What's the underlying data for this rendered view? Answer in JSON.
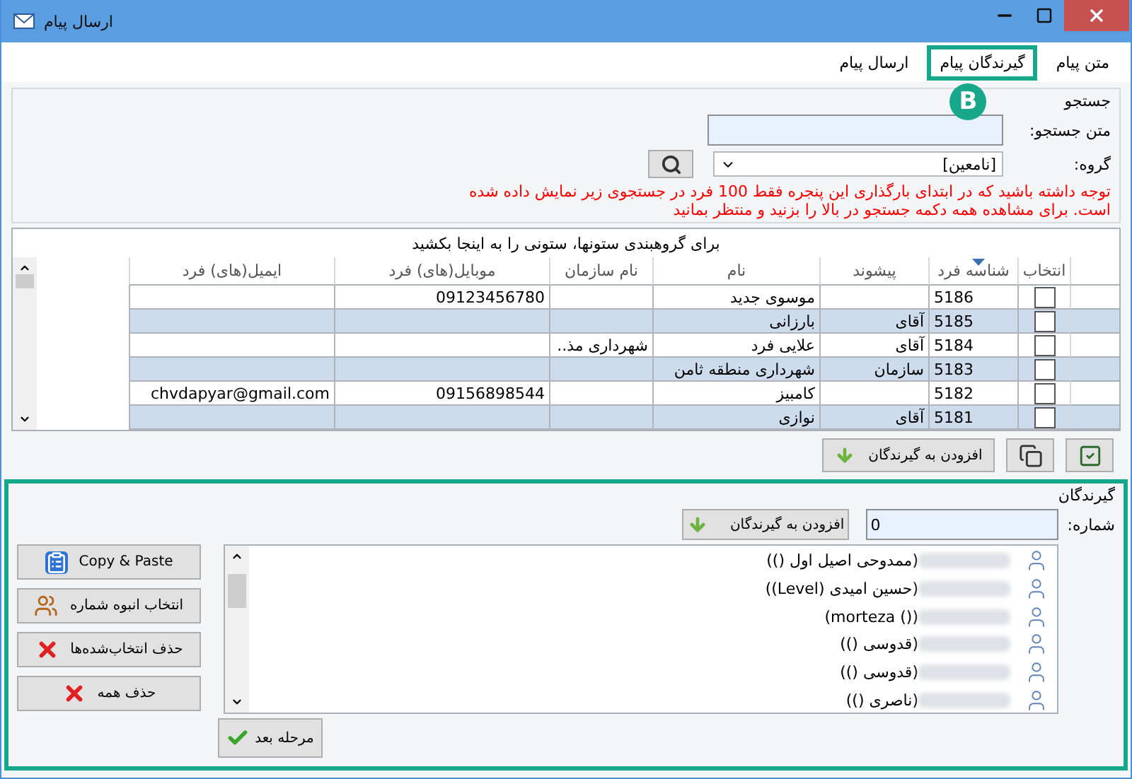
{
  "window": {
    "title": "ارسال پیام"
  },
  "tabs": [
    {
      "label": "متن پیام",
      "selected": false
    },
    {
      "label": "گیرندگان پیام",
      "selected": true,
      "badge": "B"
    },
    {
      "label": "ارسال پیام",
      "selected": false
    }
  ],
  "search": {
    "legend": "جستجو",
    "text_label": "متن جستجو:",
    "group_label": "گروه:",
    "group_value": "[نامعین]",
    "note_lines": [
      "توجه داشته باشید که در ابتدای بارگذاری این پنجره فقط 100 فرد در جستجوی زیر نمایش داده شده",
      "است. برای مشاهده همه دکمه جستجو در بالا را بزنید و منتظر بمانید"
    ]
  },
  "grid": {
    "group_hint": "برای گروهبندی ستونها، ستونی را به اینجا بکشید",
    "columns": [
      {
        "label": "انتخاب",
        "sorted": false
      },
      {
        "label": "شناسه فرد",
        "sorted": true
      },
      {
        "label": "پیشوند",
        "sorted": false
      },
      {
        "label": "نام",
        "sorted": false
      },
      {
        "label": "نام سازمان",
        "sorted": false
      },
      {
        "label": "موبایل(های) فرد",
        "sorted": false
      },
      {
        "label": "ایمیل(های) فرد",
        "sorted": false
      }
    ],
    "rows": [
      {
        "checked": false,
        "id": "5186",
        "prefix": "",
        "name": "موسوی جدید",
        "org": "",
        "mobile": "09123456780",
        "email": ""
      },
      {
        "checked": false,
        "id": "5185",
        "prefix": "آقای",
        "name": "بارزانی",
        "org": "",
        "mobile": "",
        "email": ""
      },
      {
        "checked": false,
        "id": "5184",
        "prefix": "آقای",
        "name": "علایی فرد",
        "org": "شهرداری مذ..",
        "mobile": "",
        "email": ""
      },
      {
        "checked": false,
        "id": "5183",
        "prefix": "سازمان",
        "name": "شهرداری منطقه ثامن",
        "org": "",
        "mobile": "",
        "email": ""
      },
      {
        "checked": false,
        "id": "5182",
        "prefix": "",
        "name": "کامبیز",
        "org": "",
        "mobile": "09156898544",
        "email": "chvdapyar@gmail.com"
      },
      {
        "checked": false,
        "id": "5181",
        "prefix": "آقای",
        "name": "نوازی",
        "org": "",
        "mobile": "",
        "email": ""
      }
    ]
  },
  "grid_actions": {
    "add_label": "افزودن به گیرندگان"
  },
  "recipients": {
    "highlighted": true,
    "legend": "گیرندگان",
    "number_label": "شماره:",
    "number_value": "0",
    "add_label": "افزودن به گیرندگان",
    "items": [
      "(ممدوحی اصیل اول ())",
      "(حسین امیدی (Level))",
      "(morteza ())",
      "(قدوسی ())",
      "(قدوسی ())",
      "(ناصری ())"
    ],
    "side_buttons": [
      {
        "kind": "paste",
        "label": "Copy & Paste"
      },
      {
        "kind": "bulk",
        "label": "انتخاب انبوه شماره"
      },
      {
        "kind": "delete",
        "label": "حذف انتخاب‌شده‌ها"
      },
      {
        "kind": "delete",
        "label": "حذف همه"
      }
    ],
    "next_label": "مرحله بعد"
  }
}
